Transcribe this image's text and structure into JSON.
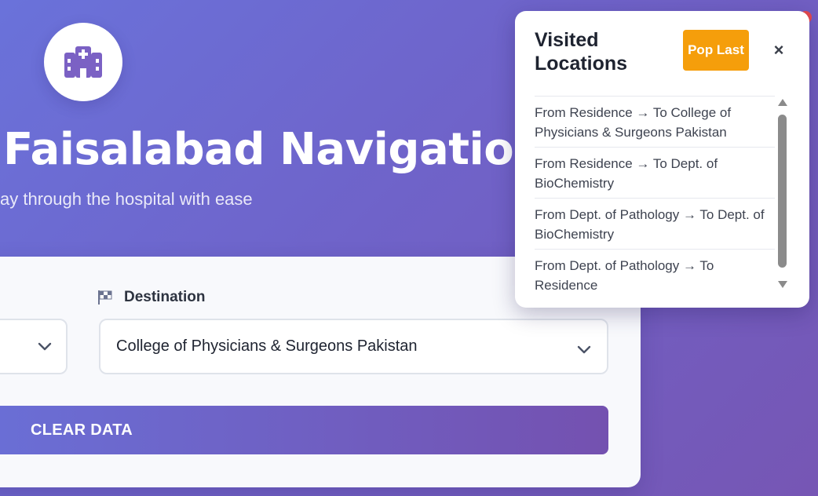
{
  "app": {
    "title": "Faisalabad Navigation",
    "subtitle": "ay through the hospital with ease",
    "logo_icon": "hospital-icon"
  },
  "form": {
    "destination_label": "Destination",
    "destination_icon": "checkered-flag-icon",
    "destination_value": "College of Physicians & Surgeons Pakistan",
    "source_value": "",
    "clear_label": "CLEAR DATA"
  },
  "visited_panel": {
    "title": "Visited Locations",
    "pop_label": "Pop Last",
    "close_glyph": "×",
    "items": [
      "From Residence → To College of Physicians & Surgeons Pakistan",
      "From Residence → To Dept. of BioChemistry",
      "From Dept. of Pathology → To Dept. of BioChemistry",
      "From Dept. of Pathology → To Residence"
    ]
  },
  "colors": {
    "accent": "#6a72da",
    "accent_end": "#7656b4",
    "pop_button": "#f59e0b",
    "card_bg": "#f8f9fc"
  }
}
